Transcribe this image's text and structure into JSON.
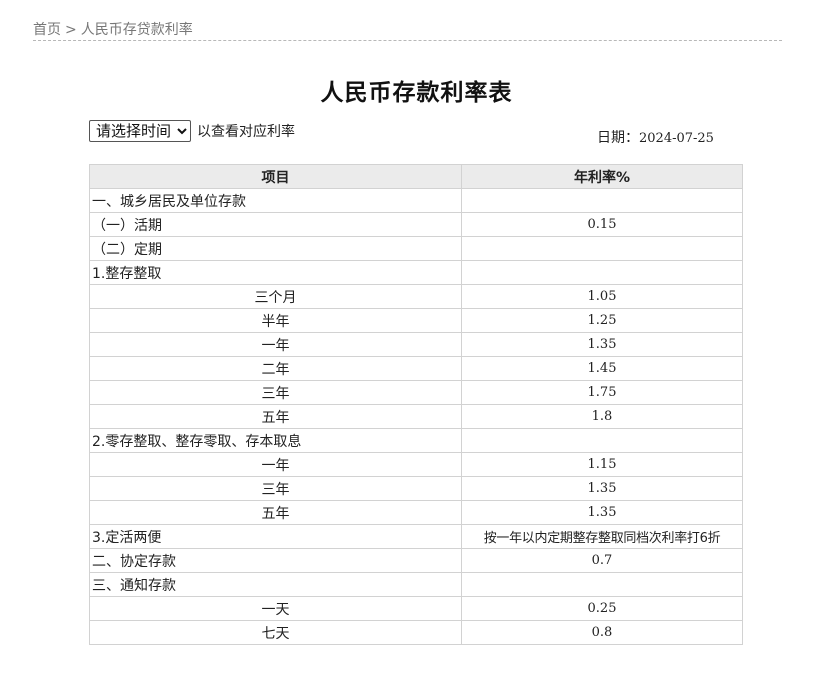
{
  "breadcrumb": {
    "home": "首页",
    "separator": ">",
    "current": "人民币存贷款利率"
  },
  "title": "人民币存款利率表",
  "controls": {
    "select_value": "请选择时间",
    "hint": "以查看对应利率"
  },
  "date": {
    "label": "日期：",
    "value": "2024-07-25"
  },
  "table": {
    "headers": [
      "项目",
      "年利率%"
    ],
    "rows": [
      {
        "item": "一、城乡居民及单位存款",
        "rate": "",
        "align": "left"
      },
      {
        "item": "（一）活期",
        "rate": "0.15",
        "align": "indent"
      },
      {
        "item": "（二）定期",
        "rate": "",
        "align": "indent"
      },
      {
        "item": "1.整存整取",
        "rate": "",
        "align": "left"
      },
      {
        "item": "三个月",
        "rate": "1.05",
        "align": "center"
      },
      {
        "item": "半年",
        "rate": "1.25",
        "align": "center"
      },
      {
        "item": "一年",
        "rate": "1.35",
        "align": "center"
      },
      {
        "item": "二年",
        "rate": "1.45",
        "align": "center"
      },
      {
        "item": "三年",
        "rate": "1.75",
        "align": "center"
      },
      {
        "item": "五年",
        "rate": "1.8",
        "align": "center"
      },
      {
        "item": "2.零存整取、整存零取、存本取息",
        "rate": "",
        "align": "left"
      },
      {
        "item": "一年",
        "rate": "1.15",
        "align": "center"
      },
      {
        "item": "三年",
        "rate": "1.35",
        "align": "center"
      },
      {
        "item": "五年",
        "rate": "1.35",
        "align": "center"
      },
      {
        "item": "3.定活两便",
        "rate": "按一年以内定期整存整取同档次利率打6折",
        "align": "left",
        "note": true
      },
      {
        "item": "二、协定存款",
        "rate": "0.7",
        "align": "left"
      },
      {
        "item": "三、通知存款",
        "rate": "",
        "align": "left"
      },
      {
        "item": "一天",
        "rate": "0.25",
        "align": "center"
      },
      {
        "item": "七天",
        "rate": "0.8",
        "align": "center"
      }
    ]
  }
}
